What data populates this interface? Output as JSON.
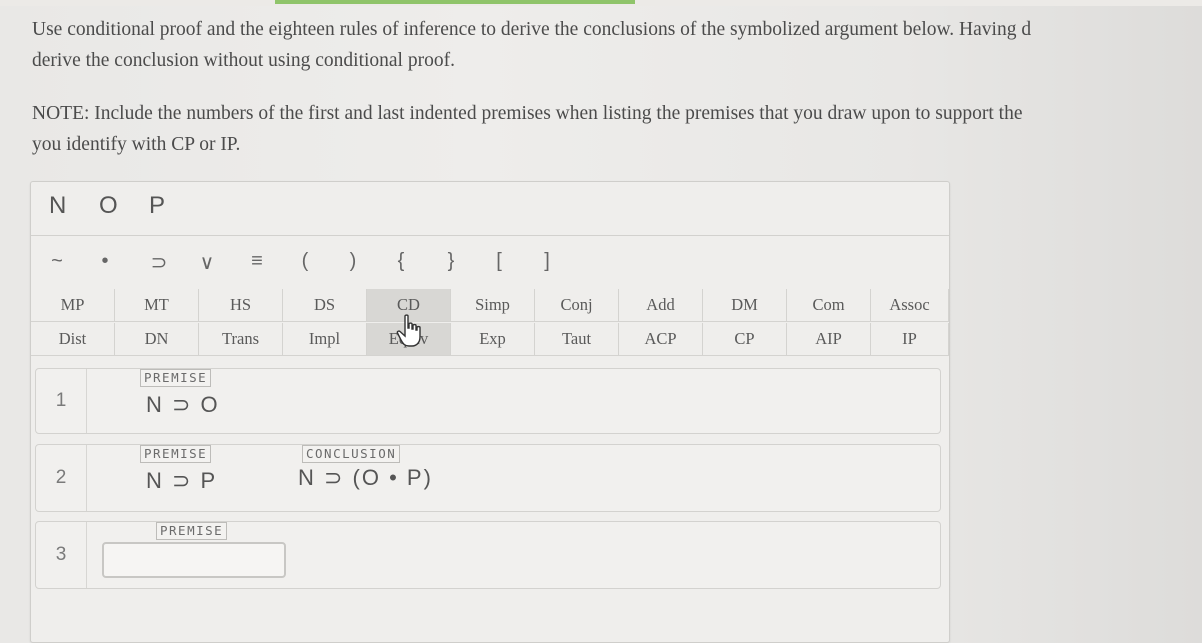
{
  "instructions": {
    "line1": "Use conditional proof and the eighteen rules of inference to derive the conclusions of the symbolized argument below. Having d",
    "line2": "derive the conclusion without using conditional proof.",
    "note1": "NOTE: Include the numbers of the first and last indented premises when listing the premises that you draw upon to support the",
    "note2": "you identify with CP or IP."
  },
  "variables": [
    "N",
    "O",
    "P"
  ],
  "symbols": [
    "~",
    "•",
    "⊃",
    "∨",
    "≡",
    "(",
    ")",
    "{",
    "}",
    "[",
    "]"
  ],
  "rules_row1": [
    "MP",
    "MT",
    "HS",
    "DS",
    "CD",
    "Simp",
    "Conj",
    "Add",
    "DM",
    "Com",
    "Assoc"
  ],
  "rules_row2": [
    "Dist",
    "DN",
    "Trans",
    "Impl",
    "Equiv",
    "Exp",
    "Taut",
    "ACP",
    "CP",
    "AIP",
    "IP"
  ],
  "proof": {
    "lines": [
      {
        "number": "1",
        "tag": "PREMISE",
        "formula": "N ⊃ O"
      },
      {
        "number": "2",
        "tag": "PREMISE",
        "formula": "N ⊃ P",
        "conclusion_tag": "CONCLUSION",
        "conclusion": "N ⊃ (O • P)"
      },
      {
        "number": "3",
        "tag": "PREMISE",
        "input_value": ""
      }
    ]
  }
}
